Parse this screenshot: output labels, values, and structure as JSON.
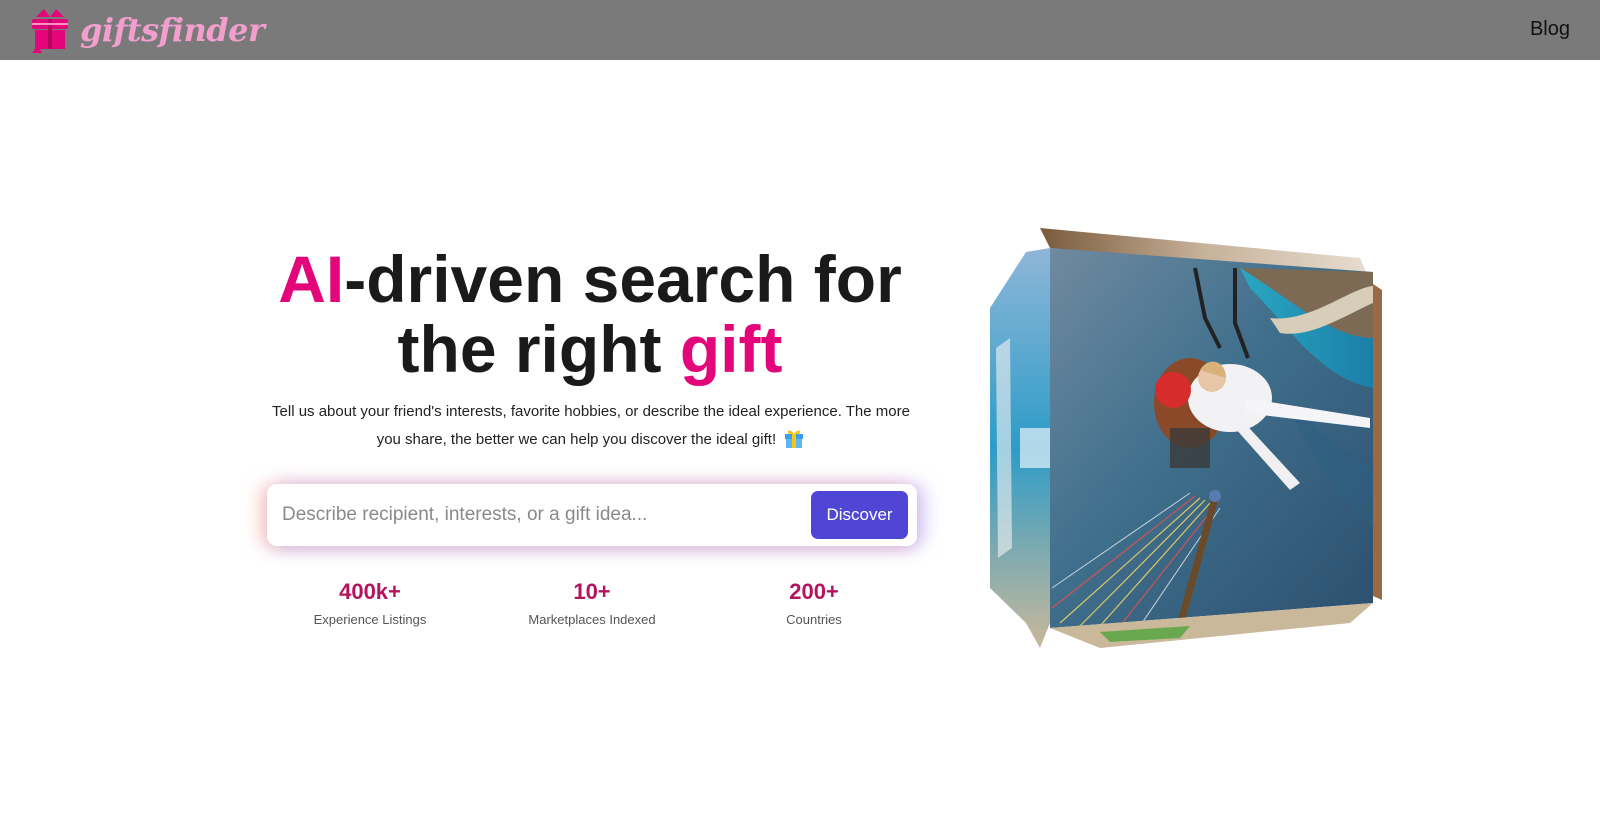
{
  "header": {
    "logo_text": "giftsfinder",
    "logo_icon": "gift-box-icon",
    "nav_blog": "Blog"
  },
  "hero": {
    "title_accent_1": "AI",
    "title_part_1": "-driven search for",
    "title_part_2": "the right ",
    "title_accent_2": "gift",
    "subtitle": "Tell us about your friend's interests, favorite hobbies, or describe the ideal experience. The more you share, the better we can help you discover the ideal gift!",
    "subtitle_icon": "wrapped-gift-emoji"
  },
  "search": {
    "placeholder": "Describe recipient, interests, or a gift idea...",
    "value": "",
    "button_label": "Discover"
  },
  "stats": [
    {
      "value": "400k+",
      "label": "Experience Listings"
    },
    {
      "value": "10+",
      "label": "Marketplaces Indexed"
    },
    {
      "value": "200+",
      "label": "Countries"
    }
  ],
  "cube": {
    "front_face": "tandem paragliding selfie over turquoise coast",
    "left_face": "beach and water scenes"
  },
  "colors": {
    "header_bg": "#7a7a7a",
    "accent_pink": "#e3067a",
    "logo_pink": "#f39fcd",
    "stat_color": "#b5125f",
    "button_bg": "#4f46d6"
  }
}
